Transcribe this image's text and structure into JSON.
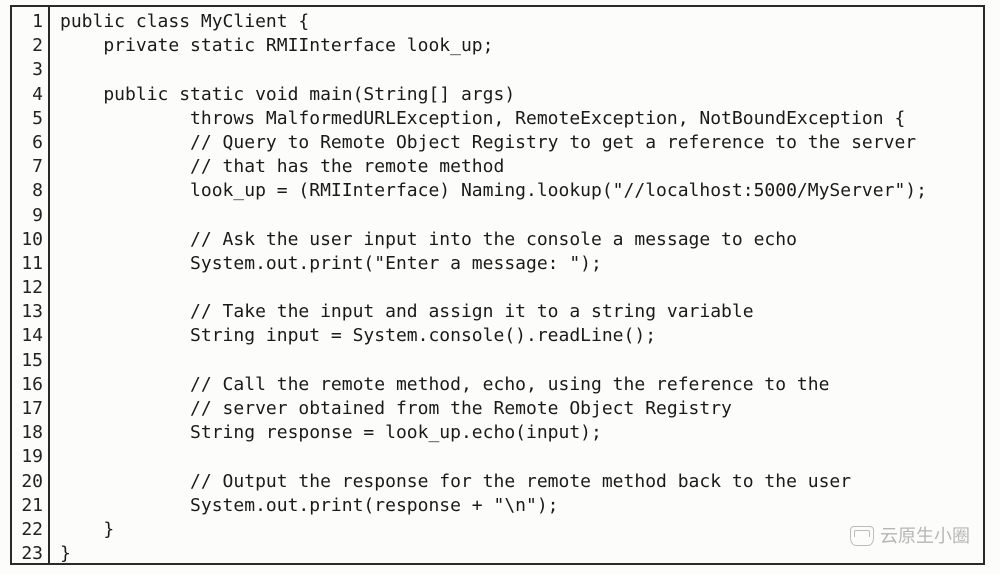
{
  "code": {
    "language": "java",
    "lines": [
      "public class MyClient {",
      "    private static RMIInterface look_up;",
      "",
      "    public static void main(String[] args)",
      "            throws MalformedURLException, RemoteException, NotBoundException {",
      "            // Query to Remote Object Registry to get a reference to the server",
      "            // that has the remote method",
      "            look_up = (RMIInterface) Naming.lookup(\"//localhost:5000/MyServer\");",
      "",
      "            // Ask the user input into the console a message to echo",
      "            System.out.print(\"Enter a message: \");",
      "",
      "            // Take the input and assign it to a string variable",
      "            String input = System.console().readLine();",
      "",
      "            // Call the remote method, echo, using the reference to the",
      "            // server obtained from the Remote Object Registry",
      "            String response = look_up.echo(input);",
      "",
      "            // Output the response for the remote method back to the user",
      "            System.out.print(response + \"\\n\");",
      "    }",
      "}"
    ],
    "line_numbers": [
      "1",
      "2",
      "3",
      "4",
      "5",
      "6",
      "7",
      "8",
      "9",
      "10",
      "11",
      "12",
      "13",
      "14",
      "15",
      "16",
      "17",
      "18",
      "19",
      "20",
      "21",
      "22",
      "23"
    ]
  },
  "watermark": {
    "text": "云原生小圈"
  }
}
